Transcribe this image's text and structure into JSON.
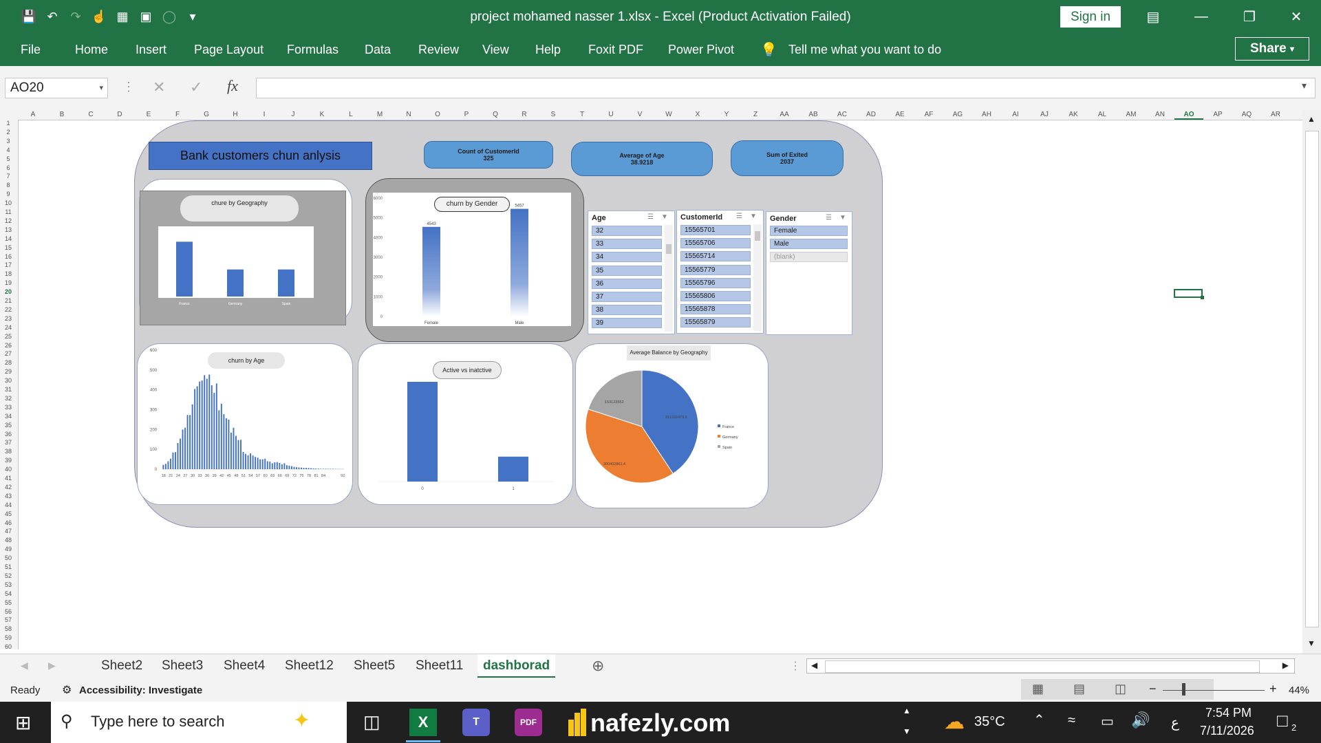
{
  "app": {
    "doc_title": "project mohamed nasser 1.xlsx  -  Excel (Product Activation Failed)",
    "sign_in": "Sign in",
    "share": "Share"
  },
  "menu": [
    "File",
    "Home",
    "Insert",
    "Page Layout",
    "Formulas",
    "Data",
    "Review",
    "View",
    "Help",
    "Foxit PDF",
    "Power Pivot"
  ],
  "tell_me": "Tell me what you want to do",
  "formula_bar": {
    "name_box": "AO20",
    "formula": ""
  },
  "columns": [
    "A",
    "B",
    "C",
    "D",
    "E",
    "F",
    "G",
    "H",
    "I",
    "J",
    "K",
    "L",
    "M",
    "N",
    "O",
    "P",
    "Q",
    "R",
    "S",
    "T",
    "U",
    "V",
    "W",
    "X",
    "Y",
    "Z",
    "AA",
    "AB",
    "AC",
    "AD",
    "AE",
    "AF",
    "AG",
    "AH",
    "AI",
    "AJ",
    "AK",
    "AL",
    "AM",
    "AN",
    "AO",
    "AP",
    "AQ",
    "AR"
  ],
  "dashboard": {
    "title": "Bank customers chun anlysis",
    "kpis": [
      {
        "label": "Count of CustomerId",
        "value": "325"
      },
      {
        "label": "Average of Age",
        "value": "38.9218"
      },
      {
        "label": "Sum of Exited",
        "value": "2037"
      }
    ],
    "slicers": {
      "age": {
        "header": "Age",
        "items": [
          "32",
          "33",
          "34",
          "35",
          "36",
          "37",
          "38",
          "39"
        ]
      },
      "customer": {
        "header": "CustomerId",
        "items": [
          "15565701",
          "15565706",
          "15565714",
          "15565779",
          "15565796",
          "15565806",
          "15565878",
          "15565879"
        ]
      },
      "gender": {
        "header": "Gender",
        "items": [
          "Female",
          "Male",
          "(blank)"
        ]
      }
    }
  },
  "chart_data": [
    {
      "type": "bar",
      "title": "chure by Geography",
      "categories": [
        "France",
        "Germany",
        "Spain"
      ],
      "values": [
        810,
        400,
        400
      ]
    },
    {
      "type": "bar",
      "title": "churn by Gender",
      "categories": [
        "Female",
        "Male"
      ],
      "values": [
        4543,
        5457
      ],
      "ylim": [
        0,
        6000
      ],
      "yticks": [
        0,
        1000,
        2000,
        3000,
        4000,
        5000,
        6000
      ],
      "data_labels": [
        "4543",
        "5457"
      ]
    },
    {
      "type": "bar",
      "title": "churn by Age",
      "ylim": [
        0,
        600
      ],
      "yticks": [
        0,
        100,
        200,
        300,
        400,
        500,
        600
      ],
      "categories": [
        "18",
        "19",
        "20",
        "21",
        "22",
        "23",
        "24",
        "25",
        "26",
        "27",
        "28",
        "29",
        "30",
        "31",
        "32",
        "33",
        "34",
        "35",
        "36",
        "37",
        "38",
        "39",
        "40",
        "41",
        "42",
        "43",
        "44",
        "45",
        "46",
        "47",
        "48",
        "49",
        "50",
        "51",
        "52",
        "53",
        "54",
        "55",
        "56",
        "57",
        "58",
        "59",
        "60",
        "61",
        "62",
        "63",
        "64",
        "65",
        "66",
        "67",
        "68",
        "69",
        "70",
        "71",
        "72",
        "73",
        "74",
        "75",
        "76",
        "77",
        "78",
        "79",
        "80",
        "81",
        "82",
        "83",
        "84",
        "85",
        "86",
        "87",
        "88",
        "89",
        "90",
        "91",
        "92"
      ],
      "values": [
        22,
        27,
        40,
        53,
        84,
        86,
        132,
        154,
        200,
        209,
        273,
        273,
        327,
        404,
        418,
        442,
        447,
        474,
        456,
        477,
        423,
        385,
        432,
        297,
        330,
        277,
        257,
        250,
        184,
        209,
        168,
        147,
        148,
        87,
        77,
        70,
        80,
        69,
        62,
        58,
        50,
        50,
        53,
        40,
        38,
        30,
        35,
        36,
        32,
        25,
        30,
        20,
        18,
        15,
        12,
        10,
        9,
        8,
        7,
        7,
        6,
        5,
        4,
        3,
        3,
        2,
        2,
        2,
        2,
        2,
        2,
        1,
        1,
        1,
        1
      ],
      "tick_labels": [
        "18",
        "21",
        "24",
        "27",
        "30",
        "33",
        "36",
        "39",
        "42",
        "45",
        "48",
        "51",
        "54",
        "57",
        "60",
        "63",
        "66",
        "69",
        "72",
        "75",
        "78",
        "81",
        "84",
        "92"
      ]
    },
    {
      "type": "bar",
      "title": "Active vs inatctive",
      "categories": [
        "0",
        "1"
      ],
      "values": [
        1000,
        250
      ]
    },
    {
      "type": "pie",
      "title": "Average Balance by Geography",
      "labels": [
        "France",
        "Germany",
        "Spain"
      ],
      "values": [
        311332479.5,
        300402861.4,
        153123552
      ],
      "data_labels": [
        "311332479.5",
        "300402861.4",
        "153123552"
      ],
      "colors": [
        "#4472c4",
        "#ed7d31",
        "#a5a5a5"
      ],
      "legend_position": "right"
    }
  ],
  "sheets": [
    "Sheet2",
    "Sheet3",
    "Sheet4",
    "Sheet12",
    "Sheet5",
    "Sheet11",
    "dashborad"
  ],
  "active_sheet": "dashborad",
  "status": {
    "ready": "Ready",
    "accessibility": "Accessibility: Investigate",
    "zoom": "44%"
  },
  "taskbar": {
    "search_placeholder": "Type here to search",
    "temperature": "35°C",
    "time": "7:54 PM",
    "date": "7/11/2026",
    "lang": "ع",
    "notifications": "2"
  },
  "watermark": "nafezly.com",
  "colors": {
    "excel_green": "#217346",
    "bar_blue": "#4472c4",
    "kpi_blue": "#5b9bd5",
    "title_blue": "#4472c4"
  }
}
